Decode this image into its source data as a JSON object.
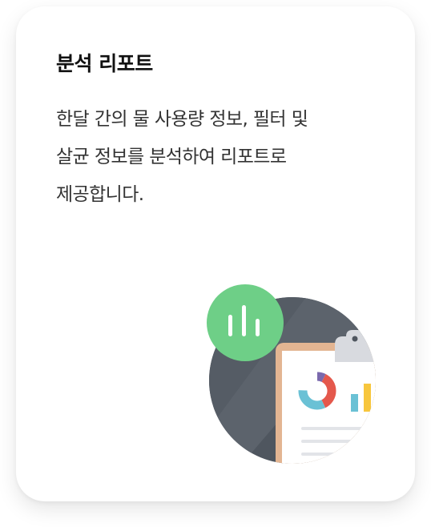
{
  "card": {
    "title": "분석 리포트",
    "description_lines": [
      "한달 간의 물 사용량 정보, 필터 및",
      "살균 정보를 분석하여 리포트로",
      "제공합니다."
    ]
  },
  "colors": {
    "circle_dark": "#4f565f",
    "circle_light": "#5c636c",
    "green_badge": "#6ecf87",
    "clipboard_border": "#e3b592",
    "clip_gray": "#d8dadf",
    "donut_blue": "#6ac1d5",
    "donut_purple": "#7a69ad",
    "donut_red": "#e4584c",
    "bar_blue": "#6ac1d5",
    "bar_yellow": "#f7c63d"
  },
  "icons": {
    "badge": "bar-chart-icon",
    "report": "clipboard-report-icon",
    "donut": "donut-chart-icon"
  }
}
